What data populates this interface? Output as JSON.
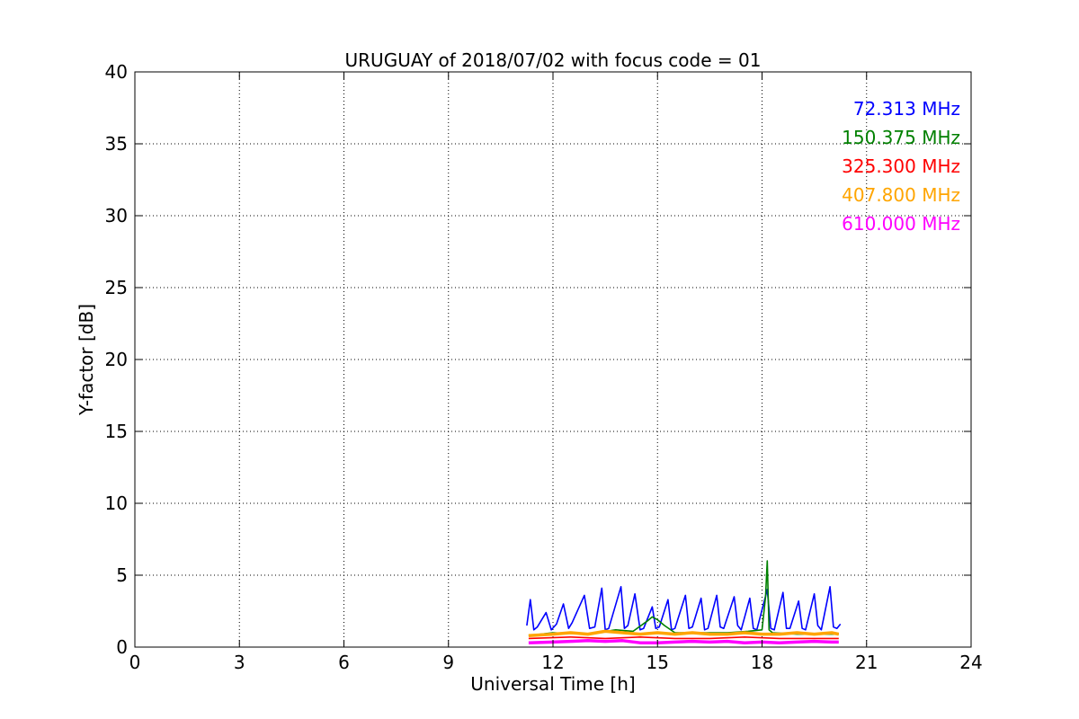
{
  "chart_data": {
    "type": "line",
    "title": "URUGUAY of 2018/07/02 with focus code = 01",
    "xlabel": "Universal Time [h]",
    "ylabel": "Y-factor [dB]",
    "xlim": [
      0,
      24
    ],
    "ylim": [
      0,
      40
    ],
    "xticks": [
      0,
      3,
      6,
      9,
      12,
      15,
      18,
      21,
      24
    ],
    "yticks": [
      0,
      5,
      10,
      15,
      20,
      25,
      30,
      35,
      40
    ],
    "grid": true,
    "legend_position": "top-right",
    "series": [
      {
        "name": "72.313 MHz",
        "color": "#0000ff",
        "x": [
          11.25,
          11.35,
          11.45,
          11.55,
          11.8,
          11.95,
          12.1,
          12.3,
          12.45,
          12.55,
          12.9,
          13.05,
          13.2,
          13.4,
          13.5,
          13.6,
          13.95,
          14.05,
          14.15,
          14.35,
          14.5,
          14.6,
          14.85,
          14.95,
          15.05,
          15.3,
          15.4,
          15.5,
          15.8,
          15.9,
          16.0,
          16.25,
          16.35,
          16.45,
          16.7,
          16.8,
          16.9,
          17.2,
          17.3,
          17.4,
          17.65,
          17.75,
          17.85,
          18.15,
          18.25,
          18.35,
          18.6,
          18.7,
          18.8,
          19.05,
          19.15,
          19.25,
          19.5,
          19.6,
          19.7,
          19.95,
          20.05,
          20.15,
          20.25
        ],
        "y": [
          1.5,
          3.3,
          1.2,
          1.4,
          2.4,
          1.2,
          1.6,
          3.0,
          1.3,
          1.7,
          3.6,
          1.3,
          1.4,
          4.1,
          1.2,
          1.3,
          4.2,
          1.3,
          1.5,
          3.7,
          1.2,
          1.3,
          2.8,
          1.3,
          1.4,
          3.3,
          1.2,
          1.3,
          3.6,
          1.3,
          1.4,
          3.4,
          1.2,
          1.3,
          3.6,
          1.4,
          1.3,
          3.5,
          1.5,
          1.2,
          3.4,
          1.3,
          1.2,
          4.0,
          1.3,
          1.2,
          3.8,
          1.3,
          1.3,
          3.2,
          1.3,
          1.2,
          3.7,
          1.5,
          1.2,
          4.2,
          1.4,
          1.3,
          1.6
        ]
      },
      {
        "name": "150.375 MHz",
        "color": "#008000",
        "x": [
          11.3,
          12.0,
          13.0,
          13.8,
          14.3,
          14.7,
          14.85,
          15.0,
          15.2,
          15.5,
          16.2,
          17.0,
          17.6,
          18.0,
          18.1,
          18.15,
          18.2,
          18.3,
          19.0,
          20.2
        ],
        "y": [
          0.8,
          1.0,
          0.9,
          1.2,
          1.1,
          1.8,
          2.1,
          1.9,
          1.5,
          1.0,
          1.0,
          1.0,
          1.1,
          1.2,
          3.5,
          6.0,
          1.2,
          1.0,
          0.9,
          0.9
        ]
      },
      {
        "name": "325.300 MHz",
        "color": "#ff0000",
        "x": [
          11.3,
          12.5,
          13.5,
          14.5,
          15.5,
          16.5,
          17.5,
          18.5,
          19.5,
          20.2
        ],
        "y": [
          0.6,
          0.7,
          0.6,
          0.7,
          0.6,
          0.6,
          0.7,
          0.6,
          0.6,
          0.6
        ]
      },
      {
        "name": "407.800 MHz",
        "color": "#ffa500",
        "x": [
          11.3,
          12.0,
          12.5,
          13.0,
          13.5,
          14.0,
          14.5,
          15.0,
          15.5,
          16.0,
          16.5,
          17.0,
          17.5,
          18.0,
          18.5,
          19.0,
          19.5,
          20.0,
          20.2
        ],
        "y": [
          0.8,
          0.9,
          1.0,
          0.9,
          1.1,
          1.0,
          0.9,
          1.0,
          0.9,
          1.0,
          0.9,
          0.9,
          1.0,
          0.9,
          0.9,
          1.0,
          0.9,
          1.0,
          0.9
        ]
      },
      {
        "name": "610.000 MHz",
        "color": "#ff00ff",
        "x": [
          11.3,
          12.0,
          12.5,
          13.0,
          13.5,
          14.0,
          14.5,
          15.0,
          15.5,
          16.0,
          16.5,
          17.0,
          17.5,
          18.0,
          18.5,
          19.0,
          19.5,
          20.0,
          20.2
        ],
        "y": [
          0.3,
          0.35,
          0.4,
          0.45,
          0.4,
          0.45,
          0.3,
          0.3,
          0.35,
          0.4,
          0.35,
          0.4,
          0.3,
          0.35,
          0.3,
          0.35,
          0.4,
          0.35,
          0.35
        ]
      }
    ]
  }
}
